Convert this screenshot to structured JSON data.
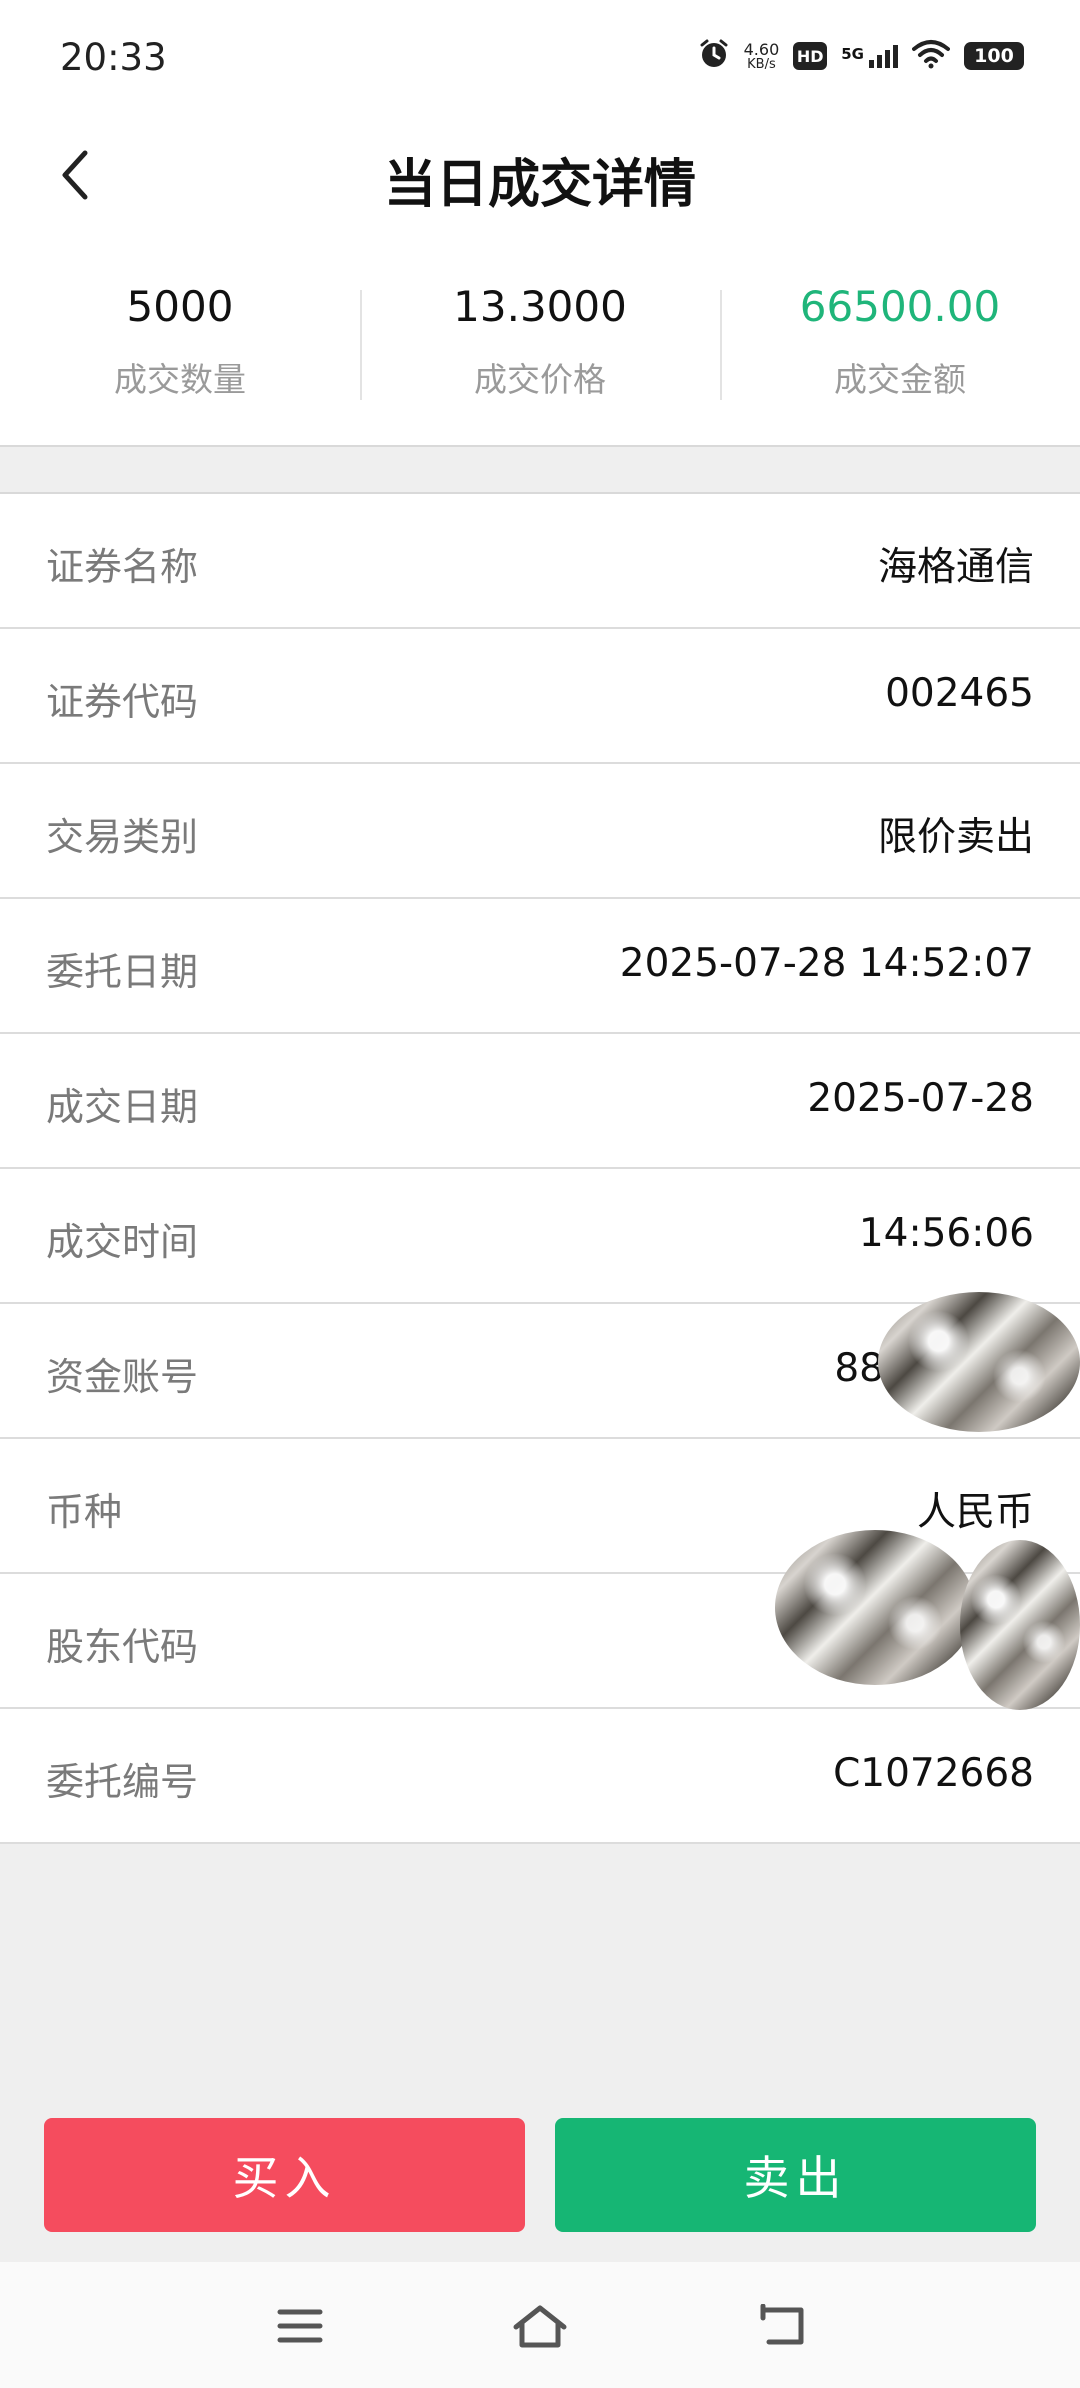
{
  "status_bar": {
    "time": "20:33",
    "net_speed": "4.60",
    "net_unit": "KB/s",
    "hd": "HD",
    "signal_label": "5G",
    "battery": "100"
  },
  "nav": {
    "title": "当日成交详情"
  },
  "summary": [
    {
      "value": "5000",
      "label": "成交数量"
    },
    {
      "value": "13.3000",
      "label": "成交价格"
    },
    {
      "value": "66500.00",
      "label": "成交金额"
    }
  ],
  "details": [
    {
      "label": "证券名称",
      "value": "海格通信"
    },
    {
      "label": "证券代码",
      "value": "002465"
    },
    {
      "label": "交易类别",
      "value": "限价卖出"
    },
    {
      "label": "委托日期",
      "value": "2025-07-28 14:52:07"
    },
    {
      "label": "成交日期",
      "value": "2025-07-28"
    },
    {
      "label": "成交时间",
      "value": "14:56:06"
    },
    {
      "label": "资金账号",
      "value": "88"
    },
    {
      "label": "币种",
      "value": "人民币"
    },
    {
      "label": "股东代码",
      "value": ""
    },
    {
      "label": "委托编号",
      "value": "C1072668"
    }
  ],
  "actions": {
    "buy": "买入",
    "sell": "卖出"
  },
  "colors": {
    "amount_green": "#1fb57a",
    "buy_red": "#f54c5e",
    "sell_green": "#16b674"
  },
  "icons": [
    "alarm-icon",
    "hd-icon",
    "signal-icon",
    "wifi-icon",
    "battery-icon",
    "back-chevron-icon",
    "menu-icon",
    "home-icon",
    "return-icon"
  ]
}
